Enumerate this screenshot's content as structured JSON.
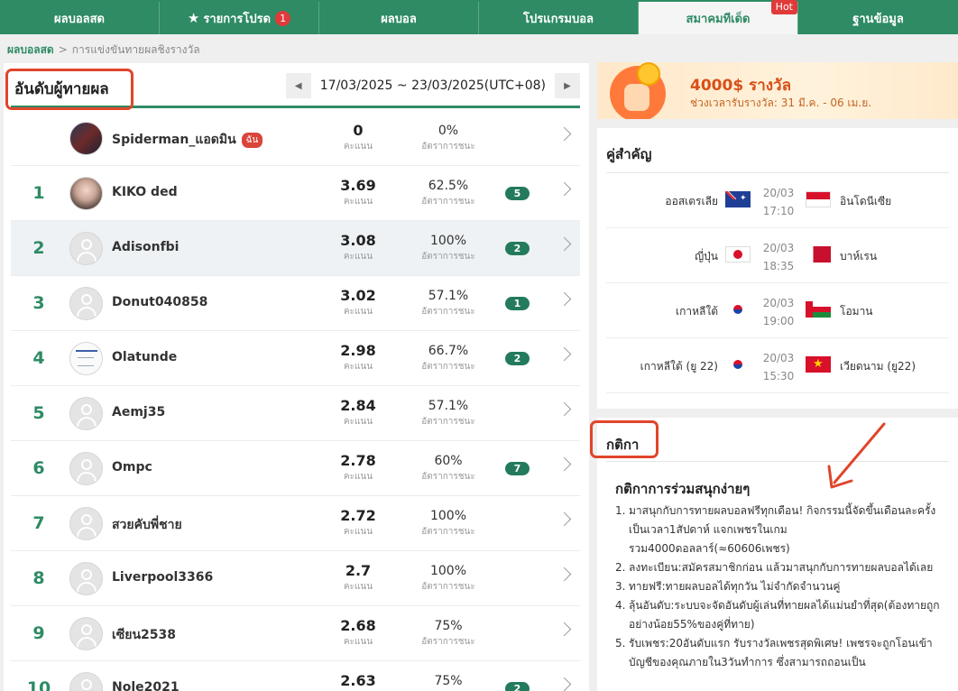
{
  "nav": {
    "tabs": [
      {
        "label": "ผลบอลสด"
      },
      {
        "label": "รายการโปรด",
        "count": "1"
      },
      {
        "label": "ผลบอล"
      },
      {
        "label": "โปรแกรมบอล"
      },
      {
        "label": "สมาคมทีเด็ด",
        "hot": "Hot"
      },
      {
        "label": "ฐานข้อมูล"
      }
    ]
  },
  "breadcrumb": {
    "home": "ผลบอลสด",
    "separator": ">",
    "current": "การแข่งขันทายผลชิงรางวัล"
  },
  "leaderboard": {
    "title": "อันดับผู้ทายผล",
    "date_range": "17/03/2025 ~ 23/03/2025(UTC+08)",
    "score_label": "คะแนน",
    "rate_label": "อัตราการชนะ",
    "me_badge": "ฉัน",
    "rows": [
      {
        "rank": "",
        "name": "Spiderman_แอดมิน",
        "me": true,
        "score": "0",
        "rate": "0%",
        "streak": ""
      },
      {
        "rank": "1",
        "name": "KIKO ded",
        "score": "3.69",
        "rate": "62.5%",
        "streak": "5"
      },
      {
        "rank": "2",
        "name": "Adisonfbi",
        "score": "3.08",
        "rate": "100%",
        "streak": "2"
      },
      {
        "rank": "3",
        "name": "Donut040858",
        "score": "3.02",
        "rate": "57.1%",
        "streak": "1"
      },
      {
        "rank": "4",
        "name": "Olatunde",
        "score": "2.98",
        "rate": "66.7%",
        "streak": "2"
      },
      {
        "rank": "5",
        "name": "Aemj35",
        "score": "2.84",
        "rate": "57.1%",
        "streak": ""
      },
      {
        "rank": "6",
        "name": "Ompc",
        "score": "2.78",
        "rate": "60%",
        "streak": "7"
      },
      {
        "rank": "7",
        "name": "สวยคับพี่ชาย",
        "score": "2.72",
        "rate": "100%",
        "streak": ""
      },
      {
        "rank": "8",
        "name": "Liverpool3366",
        "score": "2.7",
        "rate": "100%",
        "streak": ""
      },
      {
        "rank": "9",
        "name": "เซียน2538",
        "score": "2.68",
        "rate": "75%",
        "streak": ""
      },
      {
        "rank": "10",
        "name": "Nole2021",
        "score": "2.63",
        "rate": "75%",
        "streak": "2"
      }
    ]
  },
  "banner": {
    "title": "4000$ รางวัล",
    "subtitle": "ช่วงเวลารับรางวัล: 31 มี.ค. - 06 เม.ย."
  },
  "matches": {
    "title": "คู่สำคัญ",
    "items": [
      {
        "home": "ออสเตรเลีย",
        "date": "20/03",
        "time": "17:10",
        "away": "อินโดนีเซีย",
        "home_flag": "flag-au",
        "away_flag": "flag-id"
      },
      {
        "home": "ญี่ปุ่น",
        "date": "20/03",
        "time": "18:35",
        "away": "บาห์เรน",
        "home_flag": "flag-jp",
        "away_flag": "flag-bh"
      },
      {
        "home": "เกาหลีใต้",
        "date": "20/03",
        "time": "19:00",
        "away": "โอมาน",
        "home_flag": "flag-kr",
        "away_flag": "flag-om"
      },
      {
        "home": "เกาหลีใต้ (ยู 22)",
        "date": "20/03",
        "time": "15:30",
        "away": "เวียดนาม (ยู22)",
        "home_flag": "flag-kr",
        "away_flag": "flag-vn"
      }
    ]
  },
  "rules": {
    "title": "กติกา",
    "subtitle": "กติกาการร่วมสนุกง่ายๆ",
    "items": [
      {
        "num": "1.",
        "text": "มาสนุกกับการทายผลบอลฟรีทุกเดือน! กิจกรรมนี้จัดขึ้นเดือนละครั้ง เป็นเวลา1สัปดาห์ แจกเพชรในเกม รวม4000ดอลลาร์(≈60606เพชร)"
      },
      {
        "num": "2.",
        "text": "ลงทะเบียน:สมัครสมาชิกก่อน แล้วมาสนุกกับการทายผลบอลได้เลย"
      },
      {
        "num": "3.",
        "text": "ทายฟรี:ทายผลบอลได้ทุกวัน ไม่จำกัดจำนวนคู่"
      },
      {
        "num": "4.",
        "text": "ลุ้นอันดับ:ระบบจะจัดอันดับผู้เล่นที่ทายผลได้แม่นยำที่สุด(ต้องทายถูกอย่างน้อย55%ของคู่ที่ทาย)"
      },
      {
        "num": "5.",
        "text": "รับเพชร:20อันดับแรก รับรางวัลเพชรสุดพิเศษ! เพชรจะถูกโอนเข้าบัญชีของคุณภายใน3วันทำการ ซึ่งสามารถถอนเป็น"
      }
    ]
  },
  "colors": {
    "accent": "#2e8b64",
    "highlight": "#e0452b",
    "badge": "#237a5c"
  }
}
